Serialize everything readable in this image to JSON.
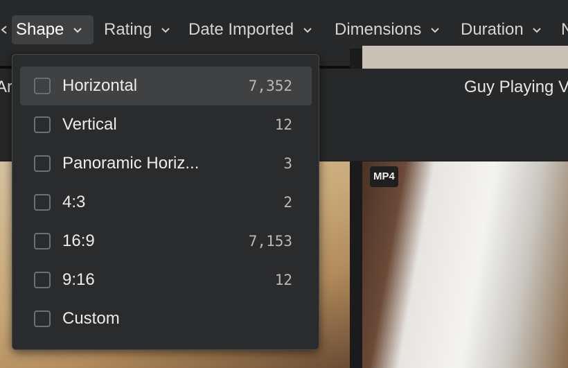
{
  "filter_bar": {
    "buttons": [
      {
        "label": "Shape"
      },
      {
        "label": "Rating"
      },
      {
        "label": "Date Imported"
      },
      {
        "label": "Dimensions"
      },
      {
        "label": "Duration"
      },
      {
        "label": "N"
      }
    ]
  },
  "gallery": {
    "caption_left": "Ar",
    "caption_right": "Guy Playing V",
    "badge": "MP4"
  },
  "shape_menu": {
    "options": [
      {
        "label": "Horizontal",
        "count": "7,352"
      },
      {
        "label": "Vertical",
        "count": "12"
      },
      {
        "label": "Panoramic Horiz...",
        "count": "3"
      },
      {
        "label": "4:3",
        "count": "2"
      },
      {
        "label": "16:9",
        "count": "7,153"
      },
      {
        "label": "9:16",
        "count": "12"
      },
      {
        "label": "Custom",
        "count": ""
      }
    ]
  }
}
